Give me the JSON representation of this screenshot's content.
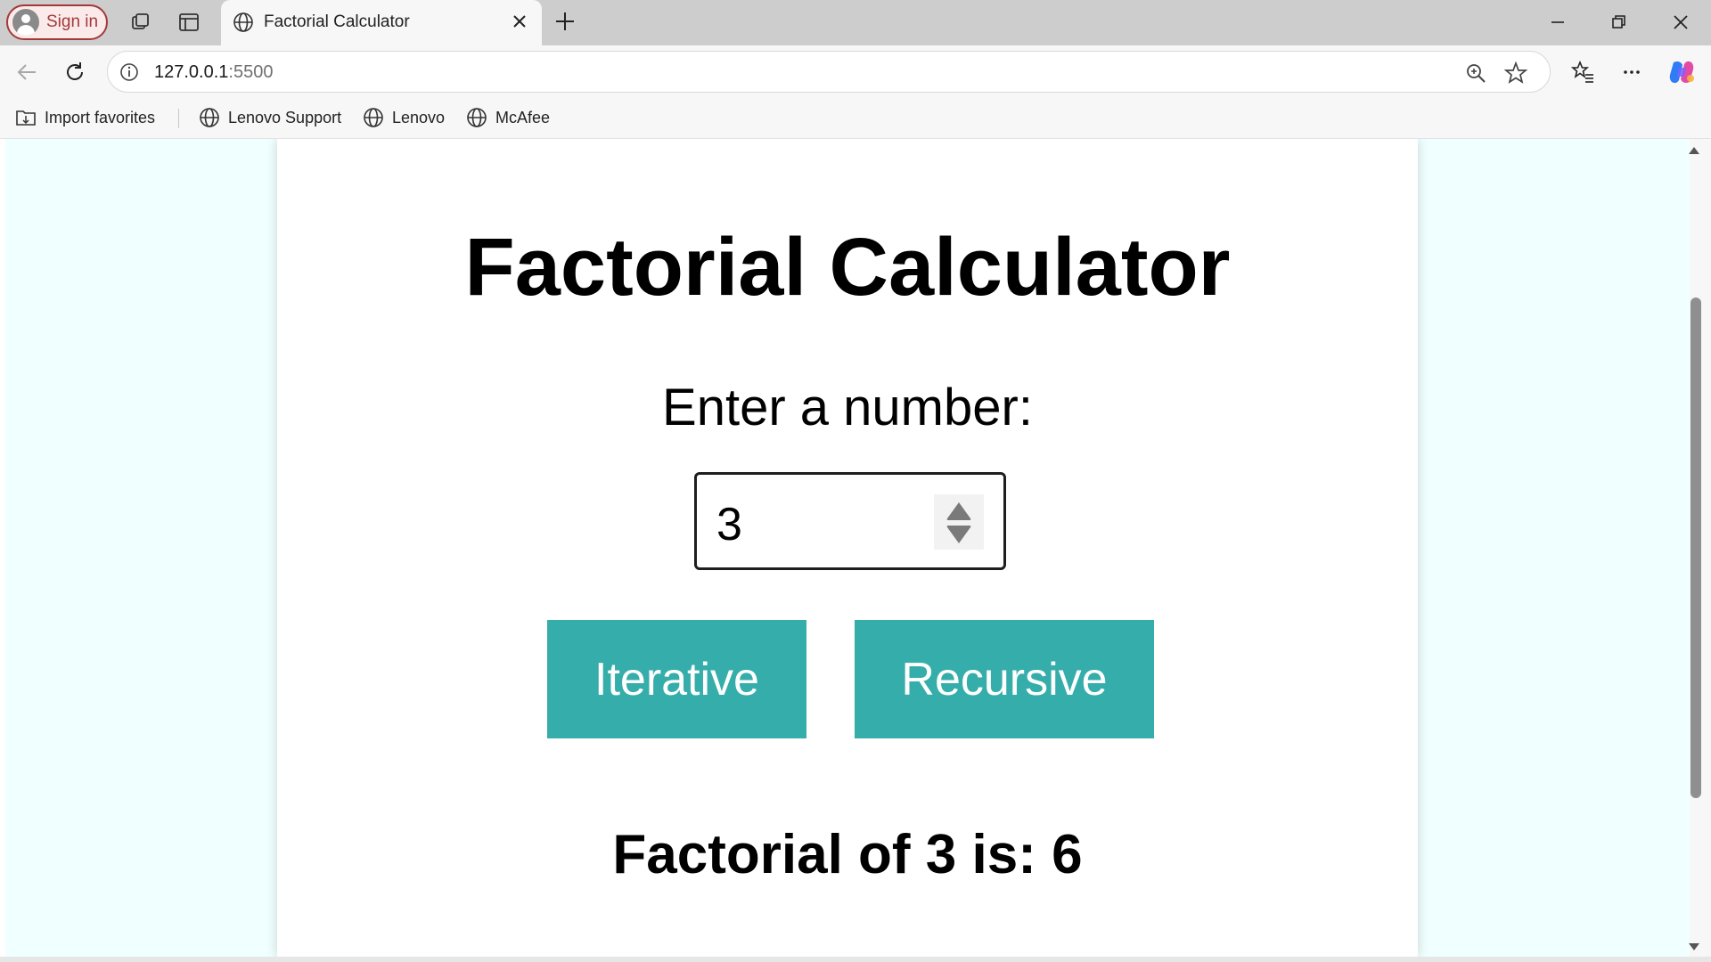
{
  "browser": {
    "signin_label": "Sign in",
    "tab_title": "Factorial Calculator",
    "url_host": "127.0.0.1",
    "url_port": ":5500",
    "favorites": [
      {
        "label": "Import favorites",
        "icon": "import-folder-icon"
      },
      {
        "label": "Lenovo Support",
        "icon": "globe-icon"
      },
      {
        "label": "Lenovo",
        "icon": "globe-icon"
      },
      {
        "label": "McAfee",
        "icon": "globe-icon"
      }
    ],
    "accent_color": "#a33a3a"
  },
  "page": {
    "title": "Factorial Calculator",
    "prompt": "Enter a number:",
    "input_value": "3",
    "buttons": {
      "iterative": "Iterative",
      "recursive": "Recursive"
    },
    "button_color": "#35adab",
    "result": "Factorial of 3 is: 6",
    "background_color": "#f0ffff"
  }
}
